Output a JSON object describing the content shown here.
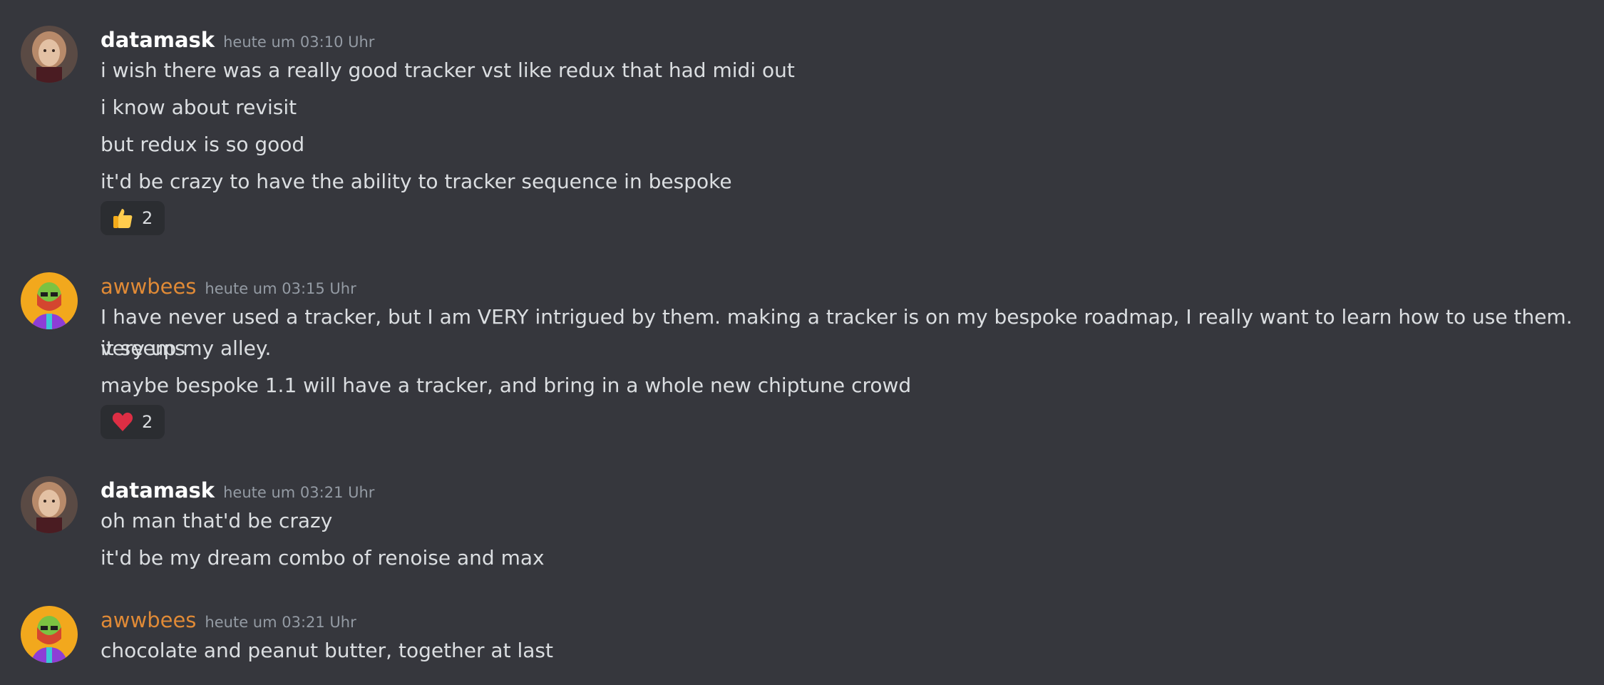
{
  "colors": {
    "background": "#36373d",
    "text": "#dbdee1",
    "timestamp": "#949ba4",
    "username_default": "#ffffff",
    "username_awwbees": "#e08a36",
    "reaction_bg": "#2b2d31"
  },
  "messages": [
    {
      "username": "datamask",
      "timestamp": "heute um 03:10 Uhr",
      "avatar_icon": "datamask-avatar",
      "lines": [
        "i wish there was a really good tracker vst like redux that had midi out",
        "i know about revisit",
        "but redux is so good",
        "it'd be crazy to have the ability to tracker sequence in bespoke"
      ],
      "reaction": {
        "icon": "thumbs-up-icon",
        "count": "2"
      }
    },
    {
      "username": "awwbees",
      "timestamp": "heute um 03:15 Uhr",
      "avatar_icon": "awwbees-avatar",
      "lines": [
        "I have never used a tracker, but I am VERY intrigued by them. making a tracker is on my bespoke roadmap, I really want to learn how to use them. it seems",
        "very up my alley.",
        "maybe bespoke 1.1 will have a tracker, and bring in a whole new chiptune crowd"
      ],
      "reaction": {
        "icon": "heart-icon",
        "count": "2"
      }
    },
    {
      "username": "datamask",
      "timestamp": "heute um 03:21 Uhr",
      "avatar_icon": "datamask-avatar",
      "lines": [
        "oh man that'd be crazy",
        "it'd be my dream combo of renoise and max"
      ]
    },
    {
      "username": "awwbees",
      "timestamp": "heute um 03:21 Uhr",
      "avatar_icon": "awwbees-avatar",
      "lines": [
        "chocolate and peanut butter, together at last"
      ]
    }
  ]
}
